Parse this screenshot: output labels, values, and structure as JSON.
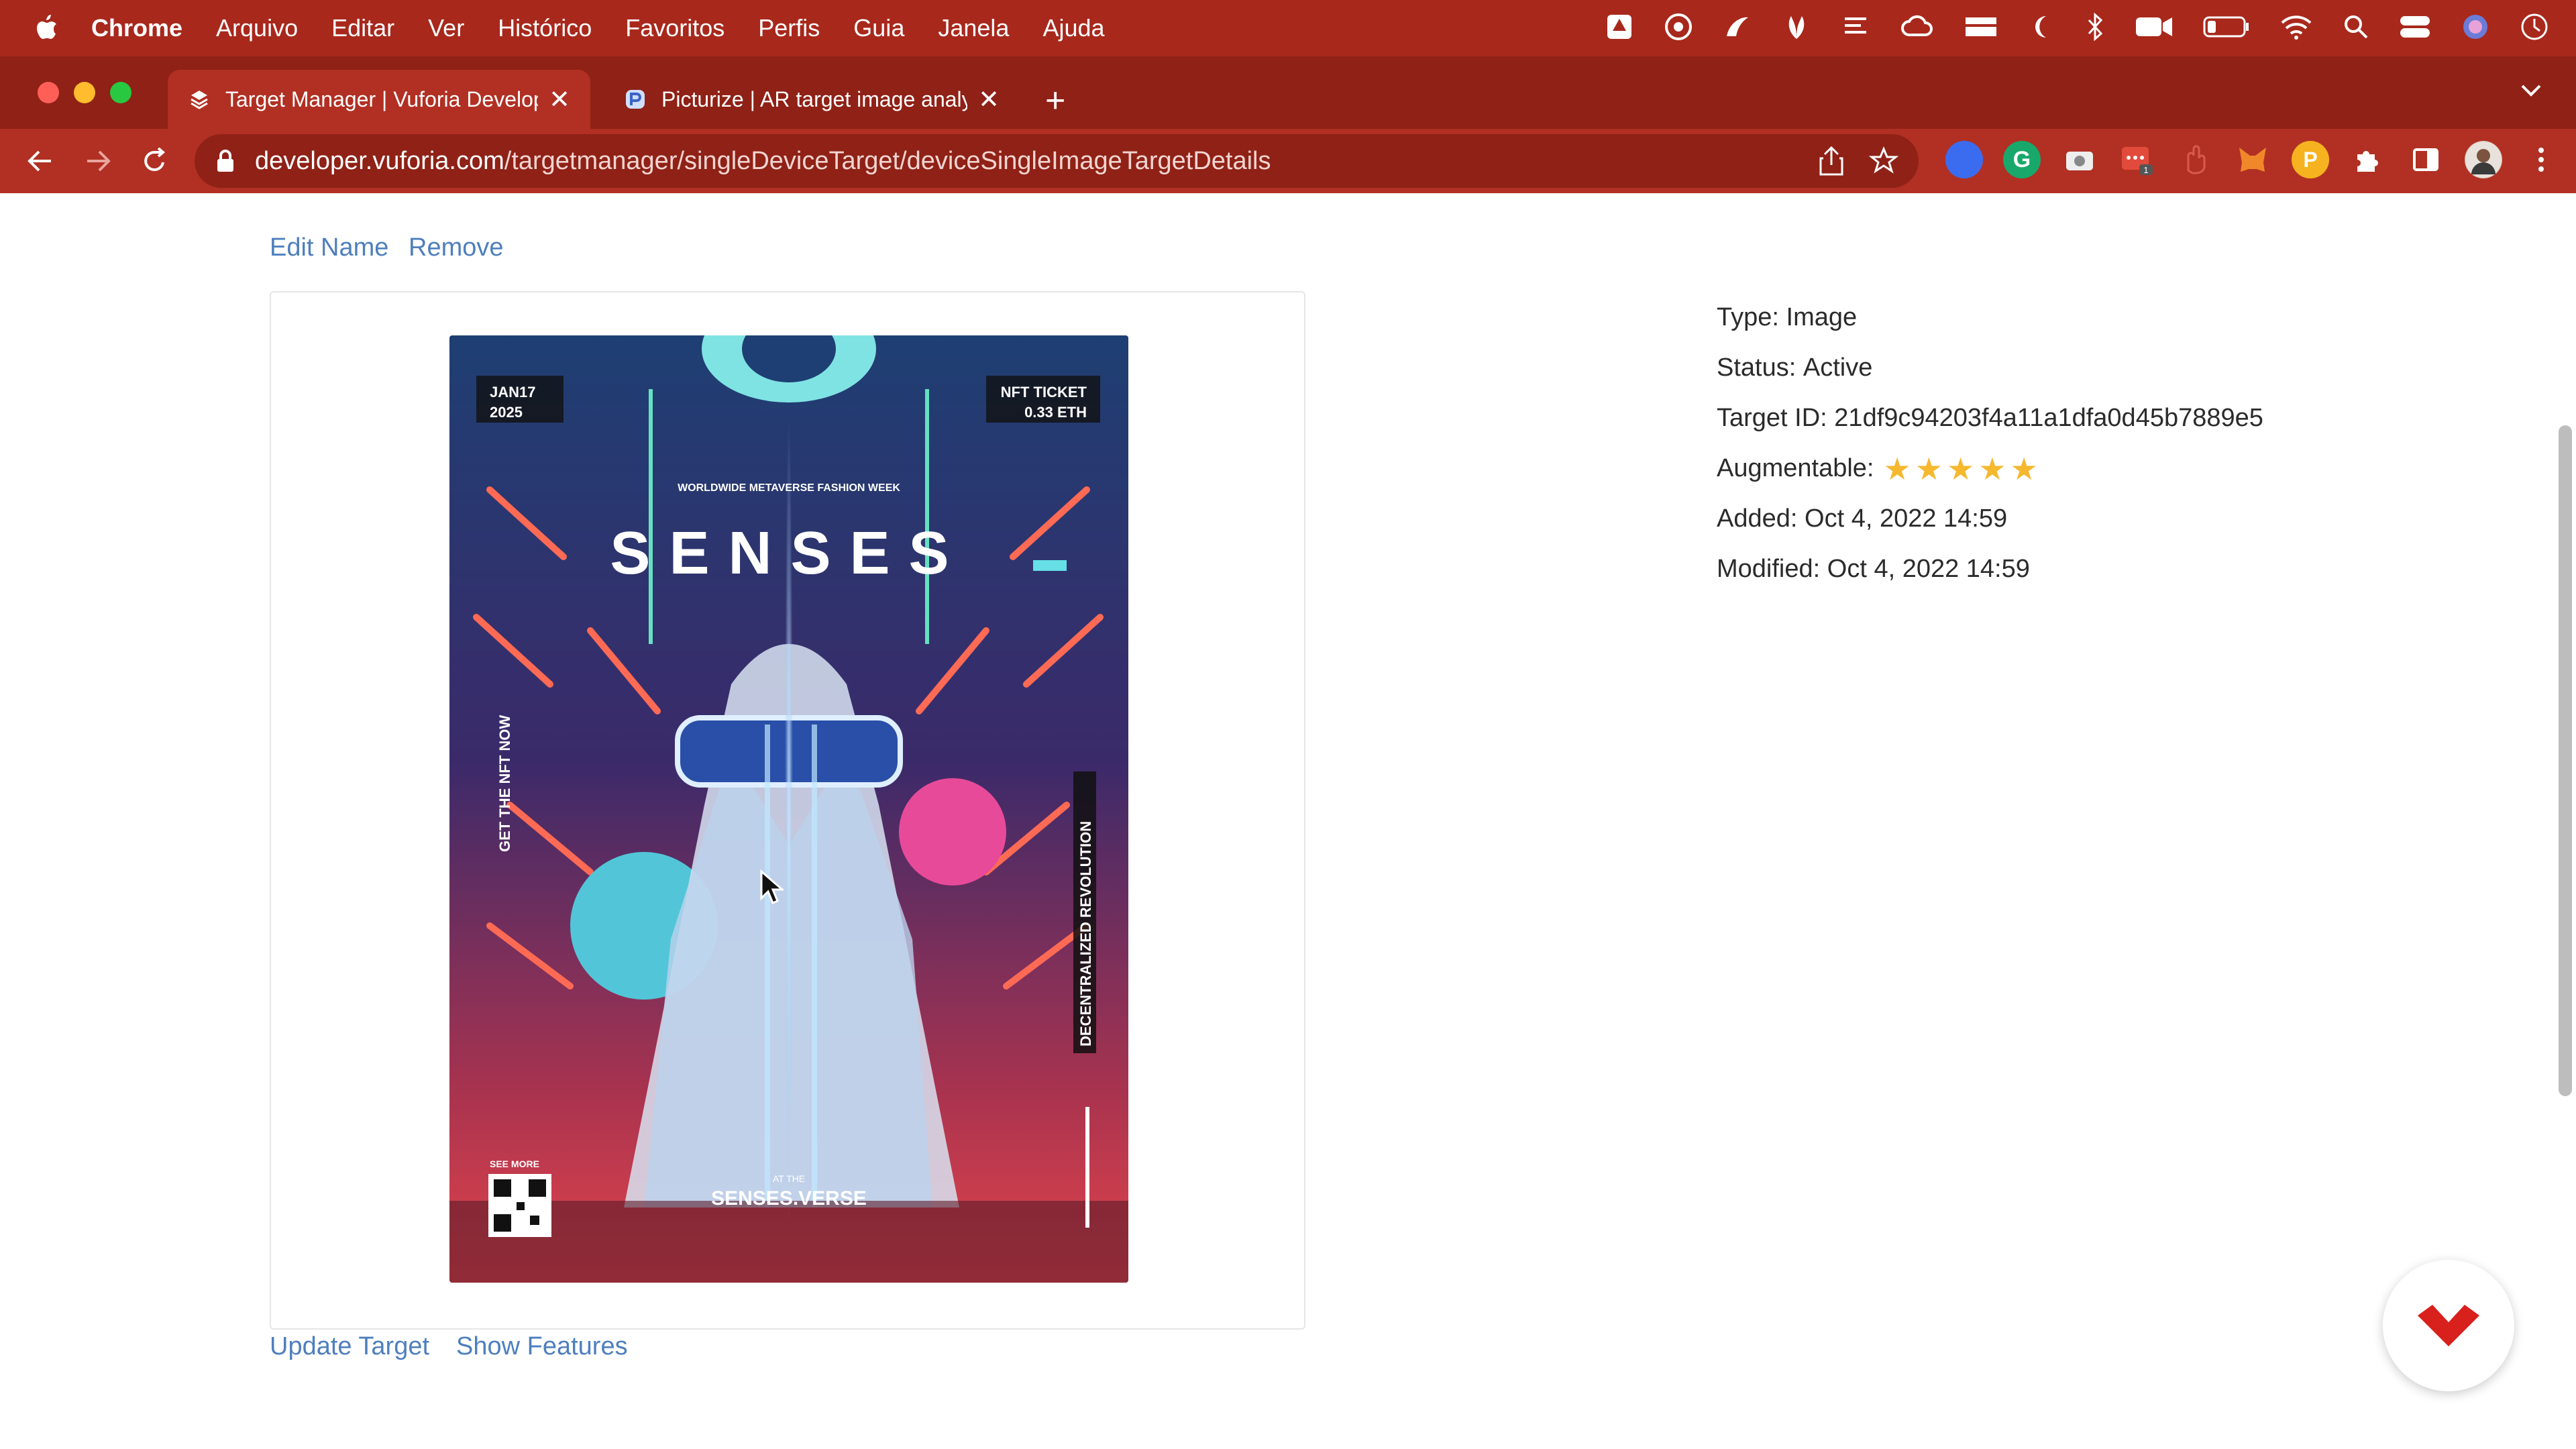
{
  "menubar": {
    "app": "Chrome",
    "items": [
      "Arquivo",
      "Editar",
      "Ver",
      "Histórico",
      "Favoritos",
      "Perfis",
      "Guia",
      "Janela",
      "Ajuda"
    ],
    "status_icons": [
      "drive-icon",
      "chrome-remote-icon",
      "screenflow-icon",
      "leaf-icon",
      "tasks-icon",
      "creative-cloud-icon",
      "apps-icon",
      "moon-icon",
      "bluetooth-icon",
      "camera-icon",
      "battery-icon",
      "wifi-icon",
      "search-icon",
      "control-center-icon",
      "siri-icon",
      "clock-icon"
    ]
  },
  "tabs": [
    {
      "title": "Target Manager | Vuforia Developer Portal",
      "active": true
    },
    {
      "title": "Picturize | AR target image analyzer",
      "active": false
    }
  ],
  "toolbar": {
    "url_host": "developer.vuforia.com",
    "url_path": "/targetmanager/singleDeviceTarget/deviceSingleImageTargetDetails"
  },
  "page": {
    "edit_name": "Edit Name",
    "remove": "Remove",
    "update_target": "Update Target",
    "show_features": "Show Features",
    "details": {
      "type_label": "Type:",
      "type_value": "Image",
      "status_label": "Status:",
      "status_value": "Active",
      "target_id_label": "Target ID:",
      "target_id_value": "21df9c94203f4a11a1dfa0d45b7889e5",
      "augmentable_label": "Augmentable:",
      "augmentable_stars": 5,
      "added_label": "Added:",
      "added_value": "Oct 4, 2022 14:59",
      "modified_label": "Modified:",
      "modified_value": "Oct 4, 2022 14:59"
    },
    "poster": {
      "date_top": "JAN17",
      "year": "2025",
      "ticket_top": "NFT TICKET",
      "ticket_price": "0.33 ETH",
      "subtitle": "WORLDWIDE METAVERSE FASHION WEEK",
      "title": "SENSES",
      "side_left": "GET THE NFT NOW",
      "side_right": "DECENTRALIZED REVOLUTION",
      "see_more": "SEE MORE",
      "at_the": "AT THE",
      "footer": "SENSES.VERSE"
    }
  }
}
